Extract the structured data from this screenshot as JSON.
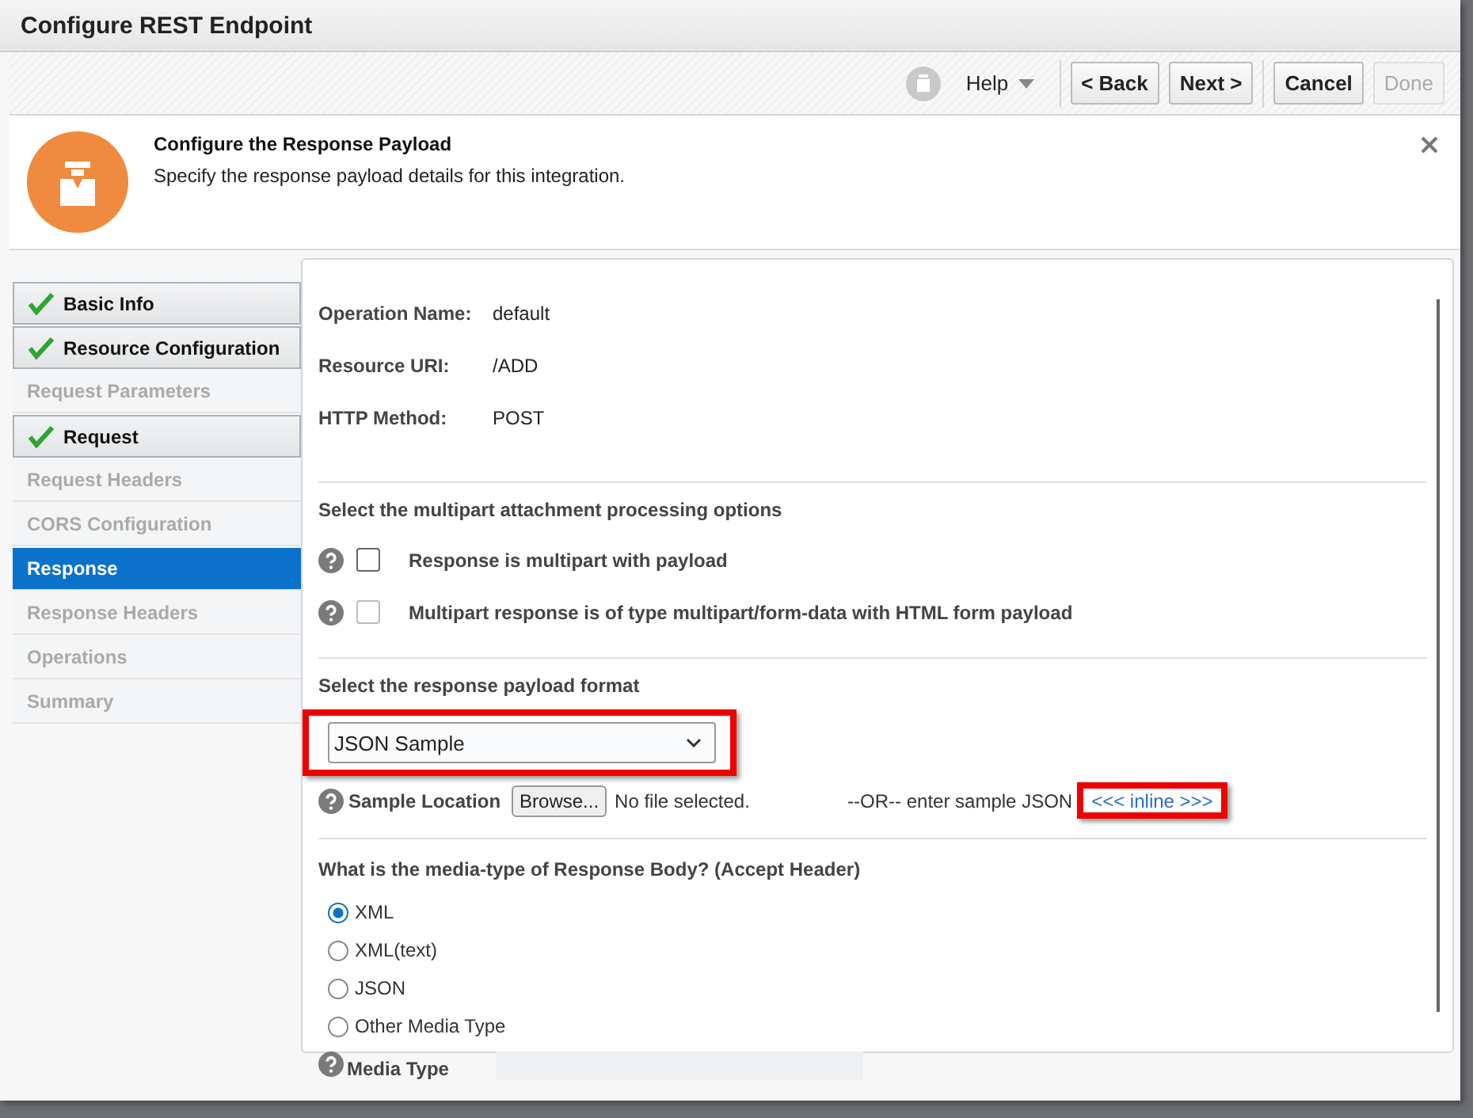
{
  "window": {
    "title": "Configure REST Endpoint"
  },
  "toolbar": {
    "help": "Help",
    "buttons": [
      {
        "label": "< Back",
        "disabled": false
      },
      {
        "label": "Next >",
        "disabled": false
      },
      {
        "label": "Cancel",
        "disabled": false
      },
      {
        "label": "Done",
        "disabled": true
      }
    ]
  },
  "header": {
    "title": "Configure the Response Payload",
    "subtitle": "Specify the response payload details for this integration."
  },
  "steps": [
    {
      "label": "Basic Info",
      "completed": true,
      "selected": false
    },
    {
      "label": "Resource Configuration",
      "completed": true,
      "selected": false
    },
    {
      "label": "Request Parameters",
      "completed": false,
      "selected": false
    },
    {
      "label": "Request",
      "completed": true,
      "selected": false
    },
    {
      "label": "Request Headers",
      "completed": false,
      "selected": false
    },
    {
      "label": "CORS Configuration",
      "completed": false,
      "selected": false
    },
    {
      "label": "Response",
      "completed": false,
      "selected": true
    },
    {
      "label": "Response Headers",
      "completed": false,
      "selected": false
    },
    {
      "label": "Operations",
      "completed": false,
      "selected": false
    },
    {
      "label": "Summary",
      "completed": false,
      "selected": false
    }
  ],
  "details": [
    {
      "label": "Operation Name:",
      "value": "default"
    },
    {
      "label": "Resource URI:",
      "value": "/ADD"
    },
    {
      "label": "HTTP Method:",
      "value": "POST"
    }
  ],
  "multipart": {
    "heading": "Select the multipart attachment processing options",
    "options": [
      {
        "label": "Response is multipart with payload",
        "checked": false,
        "disabled": false
      },
      {
        "label": "Multipart response is of type multipart/form-data with HTML form payload",
        "checked": false,
        "disabled": true
      }
    ]
  },
  "payload": {
    "heading": "Select the response payload format",
    "format": "JSON Sample",
    "highlighted": true,
    "location_label": "Sample Location",
    "browse": "Browse...",
    "file_status": "No file selected.",
    "or_text": "--OR-- enter sample JSON",
    "inline_link": "<<< inline >>>",
    "link_highlighted": true
  },
  "media": {
    "heading": "What is the media-type of Response Body? (Accept Header)",
    "options": [
      {
        "label": "XML",
        "selected": true
      },
      {
        "label": "XML(text)",
        "selected": false
      },
      {
        "label": "JSON",
        "selected": false
      },
      {
        "label": "Other Media Type",
        "selected": false
      }
    ],
    "field_label": "Media Type"
  }
}
